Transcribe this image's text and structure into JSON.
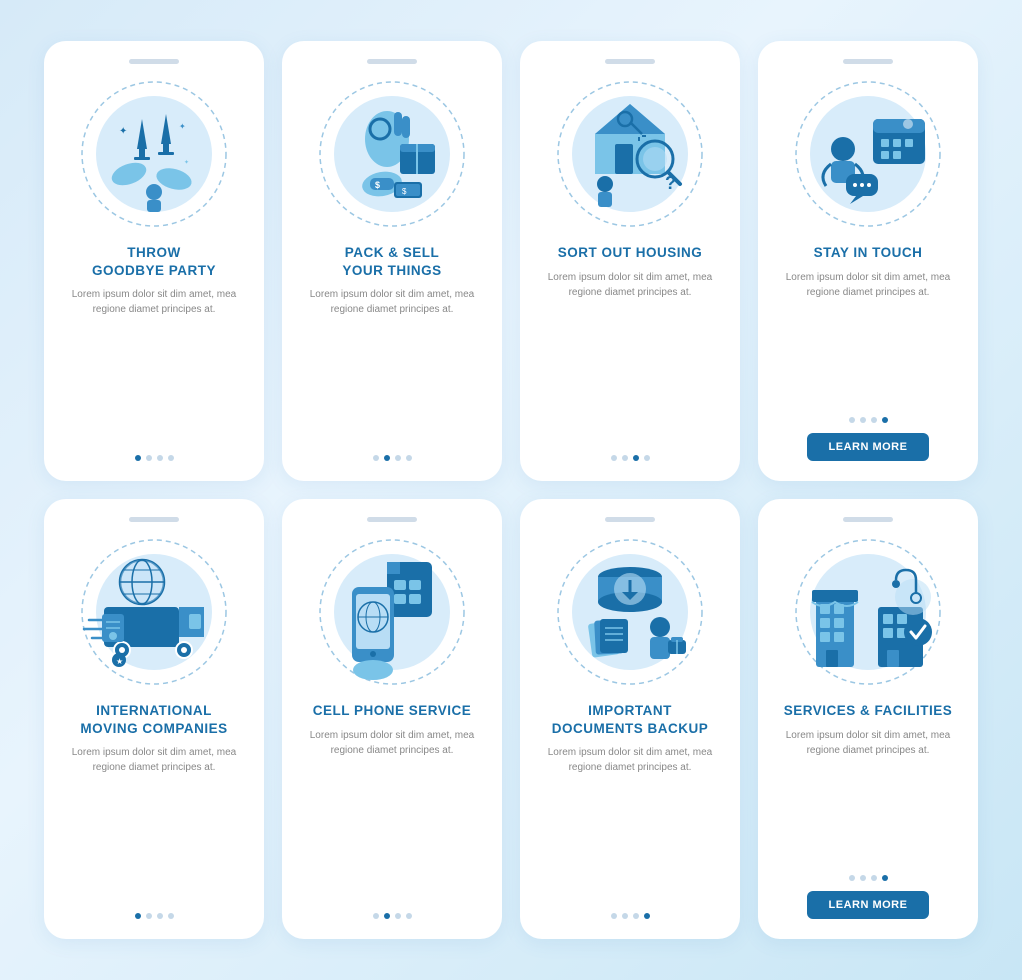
{
  "cards": [
    {
      "id": "throw-goodbye-party",
      "title": "THROW\nGOODBYE PARTY",
      "body": "Lorem ipsum dolor sit dim amet, mea regione diamet principes at.",
      "dots": [
        true,
        false,
        false,
        false
      ],
      "hasButton": false,
      "icon": "party"
    },
    {
      "id": "pack-sell-things",
      "title": "PACK & SELL\nYOUR THINGS",
      "body": "Lorem ipsum dolor sit dim amet, mea regione diamet principes at.",
      "dots": [
        false,
        true,
        false,
        false
      ],
      "hasButton": false,
      "icon": "pack"
    },
    {
      "id": "sort-out-housing",
      "title": "SORT OUT HOUSING",
      "body": "Lorem ipsum dolor sit dim amet, mea regione diamet principes at.",
      "dots": [
        false,
        false,
        true,
        false
      ],
      "hasButton": false,
      "icon": "housing"
    },
    {
      "id": "stay-in-touch",
      "title": "STAY IN TOUCH",
      "body": "Lorem ipsum dolor sit dim amet, mea regione diamet principes at.",
      "dots": [
        false,
        false,
        false,
        true
      ],
      "hasButton": true,
      "buttonLabel": "LEARN MORE",
      "icon": "touch"
    },
    {
      "id": "international-moving",
      "title": "INTERNATIONAL\nMOVING COMPANIES",
      "body": "Lorem ipsum dolor sit dim amet, mea regione diamet principes at.",
      "dots": [
        true,
        false,
        false,
        false
      ],
      "hasButton": false,
      "icon": "moving"
    },
    {
      "id": "cell-phone-service",
      "title": "CELL PHONE SERVICE",
      "body": "Lorem ipsum dolor sit dim amet, mea regione diamet principes at.",
      "dots": [
        false,
        true,
        false,
        false
      ],
      "hasButton": false,
      "icon": "phone"
    },
    {
      "id": "important-documents",
      "title": "IMPORTANT\nDOCUMENTS BACKUP",
      "body": "Lorem ipsum dolor sit dim amet, mea regione diamet principes at.",
      "dots": [
        false,
        false,
        false,
        true
      ],
      "hasButton": false,
      "icon": "documents"
    },
    {
      "id": "services-facilities",
      "title": "SERVICES & FACILITIES",
      "body": "Lorem ipsum dolor sit dim amet, mea regione diamet principes at.",
      "dots": [
        false,
        false,
        false,
        true
      ],
      "hasButton": true,
      "buttonLabel": "LEARN MORE",
      "icon": "facilities"
    }
  ],
  "learnMoreLabel": "LEARN MORE"
}
